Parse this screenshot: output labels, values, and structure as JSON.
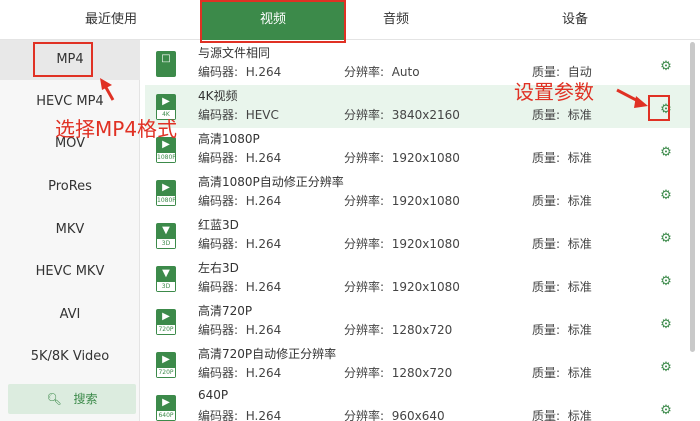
{
  "tabs": [
    {
      "label": "最近使用"
    },
    {
      "label": "视频"
    },
    {
      "label": "音频"
    },
    {
      "label": "设备"
    }
  ],
  "sidebar": {
    "items": [
      {
        "label": "MP4"
      },
      {
        "label": "HEVC MP4"
      },
      {
        "label": "MOV"
      },
      {
        "label": "ProRes"
      },
      {
        "label": "MKV"
      },
      {
        "label": "HEVC MKV"
      },
      {
        "label": "AVI"
      },
      {
        "label": "5K/8K Video"
      }
    ],
    "search_label": "搜索"
  },
  "labels": {
    "encoder": "编码器:",
    "resolution": "分辨率:",
    "quality": "质量:"
  },
  "formats": [
    {
      "name": "与源文件相同",
      "encoder": "H.264",
      "resolution": "Auto",
      "quality": "自动",
      "icon": "same-as-source-icon",
      "badge": ""
    },
    {
      "name": "4K视频",
      "encoder": "HEVC",
      "resolution": "3840x2160",
      "quality": "标准",
      "icon": "4k-video-icon",
      "badge": "4K"
    },
    {
      "name": "高清1080P",
      "encoder": "H.264",
      "resolution": "1920x1080",
      "quality": "标准",
      "icon": "hd-1080p-icon",
      "badge": "1080P"
    },
    {
      "name": "高清1080P自动修正分辨率",
      "encoder": "H.264",
      "resolution": "1920x1080",
      "quality": "标准",
      "icon": "hd-1080p-auto-icon",
      "badge": "1080P"
    },
    {
      "name": "红蓝3D",
      "encoder": "H.264",
      "resolution": "1920x1080",
      "quality": "标准",
      "icon": "3d-red-blue-icon",
      "badge": "3D"
    },
    {
      "name": "左右3D",
      "encoder": "H.264",
      "resolution": "1920x1080",
      "quality": "标准",
      "icon": "3d-side-by-side-icon",
      "badge": "3D"
    },
    {
      "name": "高清720P",
      "encoder": "H.264",
      "resolution": "1280x720",
      "quality": "标准",
      "icon": "hd-720p-icon",
      "badge": "720P"
    },
    {
      "name": "高清720P自动修正分辨率",
      "encoder": "H.264",
      "resolution": "1280x720",
      "quality": "标准",
      "icon": "hd-720p-auto-icon",
      "badge": "720P"
    },
    {
      "name": "640P",
      "encoder": "H.264",
      "resolution": "960x640",
      "quality": "标准",
      "icon": "640p-icon",
      "badge": "640P"
    }
  ],
  "annotations": {
    "select_mp4": "选择MP4格式",
    "set_params": "设置参数"
  },
  "colors": {
    "accent": "#3c8a4a",
    "annotation": "#e03124"
  }
}
